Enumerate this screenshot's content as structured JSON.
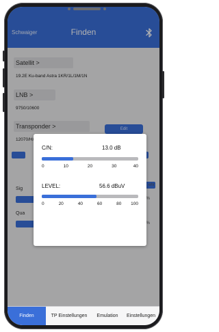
{
  "app": {
    "brand": "Schwaiger",
    "title": "Finden"
  },
  "satellite": {
    "label": "Satellit >",
    "value": "19.2E Ku-band Astra 1KR/1L/1M/1N"
  },
  "lnb": {
    "label": "LNB >",
    "value": "9750/10600"
  },
  "transponder": {
    "label": "Transponder >",
    "value": "12070/H/27500",
    "edit_label": "Edit"
  },
  "signal_rows": {
    "signal_label": "Sig",
    "signal_pct": "85%",
    "quality_label": "Qua",
    "quality_pct": "80%",
    "side_button_label": "ehr"
  },
  "meter_dialog": {
    "cn": {
      "label": "C/N:",
      "value": "13.0 dB",
      "level": 13,
      "max": 40,
      "ticks": [
        "0",
        "10",
        "20",
        "30",
        "40"
      ]
    },
    "level": {
      "label": "LEVEL:",
      "value": "56.6 dBuV",
      "level": 56.6,
      "max": 100,
      "ticks": [
        "0",
        "20",
        "40",
        "60",
        "80",
        "100"
      ]
    }
  },
  "tabs": [
    {
      "label": "Finden",
      "active": true
    },
    {
      "label": "TP Einstellungen",
      "active": false
    },
    {
      "label": "Emulation",
      "active": false
    },
    {
      "label": "Einstellungen",
      "active": false
    }
  ],
  "colors": {
    "accent": "#3a6fd9",
    "bar_track": "#b9b9bc",
    "phone_frame": "#1b1b1e"
  }
}
